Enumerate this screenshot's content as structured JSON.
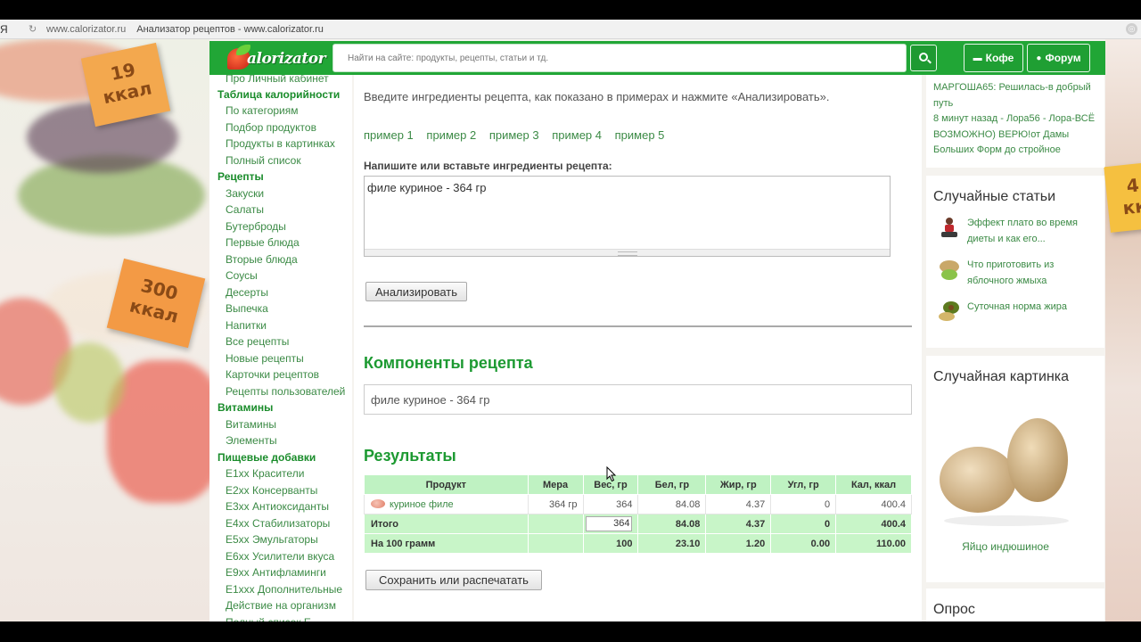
{
  "browser": {
    "yandex_letter": "Я",
    "url": "www.calorizator.ru",
    "title": "Анализатор рецептов - www.calorizator.ru"
  },
  "header": {
    "logo_text": "alorizator",
    "search_placeholder": "Найти на сайте: продукты, рецепты, статьи и тд.",
    "coffee_label": "Кофе",
    "forum_label": "Форум"
  },
  "stickers": {
    "top_left": [
      "19",
      "ккал"
    ],
    "mid_left": [
      "300",
      "ккал"
    ],
    "top_right": [
      "4",
      "кк"
    ]
  },
  "sidebar": {
    "items": [
      {
        "type": "item",
        "label": "Про Личный кабинет"
      },
      {
        "type": "sec",
        "label": "Таблица калорийности"
      },
      {
        "type": "item",
        "label": "По категориям"
      },
      {
        "type": "item",
        "label": "Подбор продуктов"
      },
      {
        "type": "item",
        "label": "Продукты в картинках"
      },
      {
        "type": "item",
        "label": "Полный список"
      },
      {
        "type": "sec",
        "label": "Рецепты"
      },
      {
        "type": "item",
        "label": "Закуски"
      },
      {
        "type": "item",
        "label": "Салаты"
      },
      {
        "type": "item",
        "label": "Бутерброды"
      },
      {
        "type": "item",
        "label": "Первые блюда"
      },
      {
        "type": "item",
        "label": "Вторые блюда"
      },
      {
        "type": "item",
        "label": "Соусы"
      },
      {
        "type": "item",
        "label": "Десерты"
      },
      {
        "type": "item",
        "label": "Выпечка"
      },
      {
        "type": "item",
        "label": "Напитки"
      },
      {
        "type": "item",
        "label": "Все рецепты"
      },
      {
        "type": "item",
        "label": "Новые рецепты"
      },
      {
        "type": "item",
        "label": "Карточки рецептов"
      },
      {
        "type": "item",
        "label": "Рецепты пользователей"
      },
      {
        "type": "sec",
        "label": "Витамины"
      },
      {
        "type": "item",
        "label": "Витамины"
      },
      {
        "type": "item",
        "label": "Элементы"
      },
      {
        "type": "sec",
        "label": "Пищевые добавки"
      },
      {
        "type": "item",
        "label": "E1xx Красители"
      },
      {
        "type": "item",
        "label": "E2xx Консерванты"
      },
      {
        "type": "item",
        "label": "E3xx Антиоксиданты"
      },
      {
        "type": "item",
        "label": "E4xx Стабилизаторы"
      },
      {
        "type": "item",
        "label": "E5xx Эмульгаторы"
      },
      {
        "type": "item",
        "label": "E6xx Усилители вкуса"
      },
      {
        "type": "item",
        "label": "E9xx Антифламинги"
      },
      {
        "type": "item",
        "label": "E1xxx Дополнительные"
      },
      {
        "type": "item",
        "label": "Действие на организм"
      },
      {
        "type": "item",
        "label": "Полный список Е"
      }
    ]
  },
  "main": {
    "intro": "Введите ингредиенты рецепта, как показано в примерах и нажмите «Анализировать».",
    "examples": [
      "пример 1",
      "пример 2",
      "пример 3",
      "пример 4",
      "пример 5"
    ],
    "field_label": "Напишите или вставьте ингредиенты рецепта:",
    "textarea_value": "филе куриное - 364 гр",
    "analyze_button": "Анализировать",
    "components_title": "Компоненты рецепта",
    "components_value": "филе куриное - 364 гр",
    "results_title": "Результаты",
    "save_button": "Сохранить или распечатать"
  },
  "results": {
    "headers": [
      "Продукт",
      "Мера",
      "Вес, гр",
      "Бел, гр",
      "Жир, гр",
      "Угл, гр",
      "Кал, ккал"
    ],
    "row": {
      "product": "куриное филе",
      "measure": "364 гр",
      "weight": "364",
      "protein": "84.08",
      "fat": "4.37",
      "carbs": "0",
      "kcal": "400.4"
    },
    "total": {
      "label": "Итого",
      "weight": "364",
      "protein": "84.08",
      "fat": "4.37",
      "carbs": "0",
      "kcal": "400.4"
    },
    "per100": {
      "label": "На 100 грамм",
      "weight": "100",
      "protein": "23.10",
      "fat": "1.20",
      "carbs": "0.00",
      "kcal": "110.00"
    }
  },
  "right": {
    "activity": [
      "МАРГОША65: Решилась-в добрый путь",
      "8 минут назад - Лора56 - Лора-ВСЁ ВОЗМОЖНО) ВЕРЮ!от Дамы Больших Форм до стройное"
    ],
    "random_articles_title": "Случайные статьи",
    "articles": [
      "Эффект плато во время диеты и как его...",
      "Что приготовить из яблочного жмыха",
      "Суточная норма жира"
    ],
    "random_picture_title": "Случайная картинка",
    "picture_caption": "Яйцо индюшиное",
    "poll_title": "Опрос"
  }
}
